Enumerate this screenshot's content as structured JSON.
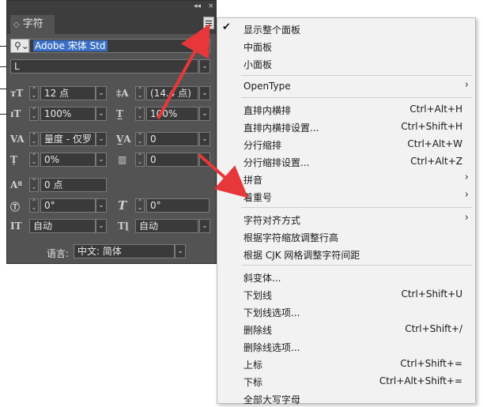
{
  "panel": {
    "title": "字符",
    "strip_controls": [
      "◂◂",
      "×"
    ],
    "font": {
      "value": "Adobe 宋体 Std"
    },
    "style": {
      "value": "L"
    },
    "size": {
      "value": "12 点"
    },
    "leading": {
      "value": "(14.4 点)"
    },
    "vertical_scale": {
      "value": "100%"
    },
    "horizontal_scale": {
      "value": "100%"
    },
    "kerning": {
      "value": "量度 - 仅罗"
    },
    "tracking": {
      "value": "0"
    },
    "tsume": {
      "value": "0%"
    },
    "aki": {
      "value": "0"
    },
    "baseline_shift": {
      "value": "0 点"
    },
    "rotation": {
      "value": "0°"
    },
    "skew": {
      "value": "0°"
    },
    "auto_left": {
      "value": "自动"
    },
    "auto_right": {
      "value": "自动"
    },
    "language": {
      "label": "语言:",
      "value": "中文: 简体"
    }
  },
  "menu": {
    "items": [
      {
        "label": "显示整个面板",
        "checked": true
      },
      {
        "label": "中面板"
      },
      {
        "label": "小面板"
      },
      {
        "label": "OpenType",
        "submenu": true
      },
      {
        "label": "直排内横排",
        "shortcut": "Ctrl+Alt+H"
      },
      {
        "label": "直排内横排设置...",
        "shortcut": "Ctrl+Shift+H"
      },
      {
        "label": "分行缩排",
        "shortcut": "Ctrl+Alt+W"
      },
      {
        "label": "分行缩排设置...",
        "shortcut": "Ctrl+Alt+Z"
      },
      {
        "label": "拼音",
        "submenu": true
      },
      {
        "label": "着重号",
        "submenu": true
      },
      {
        "label": "字符对齐方式",
        "submenu": true
      },
      {
        "label": "根据字符缩放调整行高"
      },
      {
        "label": "根据 CJK 网格调整字符间距"
      },
      {
        "label": "斜变体..."
      },
      {
        "label": "下划线",
        "shortcut": "Ctrl+Shift+U"
      },
      {
        "label": "下划线选项..."
      },
      {
        "label": "删除线",
        "shortcut": "Ctrl+Shift+/"
      },
      {
        "label": "删除线选项..."
      },
      {
        "label": "上标",
        "shortcut": "Ctrl+Shift+="
      },
      {
        "label": "下标",
        "shortcut": "Ctrl+Alt+Shift+="
      },
      {
        "label": "全部大写字母"
      }
    ]
  },
  "colors": {
    "panel_bg": "#535353",
    "menu_bg": "#f2f2f2",
    "arrow": "#e8373a",
    "selection": "#3a6fc4"
  }
}
